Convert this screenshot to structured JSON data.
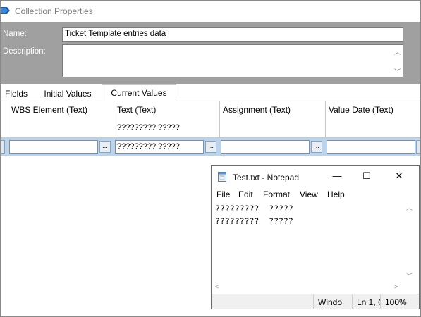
{
  "window": {
    "title": "Collection Properties"
  },
  "properties": {
    "name_label": "Name:",
    "name_value": "Ticket Template entries data",
    "description_label": "Description:",
    "description_value": ""
  },
  "tabs": [
    {
      "label": "Fields",
      "active": false
    },
    {
      "label": "Initial Values",
      "active": false
    },
    {
      "label": "Current Values",
      "active": true
    }
  ],
  "grid": {
    "columns": [
      {
        "title": "WBS Element  (Text)",
        "sample": ""
      },
      {
        "title": "Text  (Text)",
        "sample": "????????? ?????"
      },
      {
        "title": "Assignment  (Text)",
        "sample": ""
      },
      {
        "title": "Value Date  (Text)",
        "sample": ""
      }
    ],
    "edit_row": [
      "",
      "????????? ?????",
      "",
      ""
    ],
    "ellipsis": "..."
  },
  "notepad": {
    "title": "Test.txt - Notepad",
    "controls": {
      "minimize": "—",
      "maximize": "☐",
      "close": "✕"
    },
    "menu": [
      "File",
      "Edit",
      "Format",
      "View",
      "Help"
    ],
    "lines": [
      "?????????  ?????",
      "?????????  ?????"
    ],
    "status": {
      "encoding": "Windo",
      "position": "Ln 1, C",
      "zoom": "100%"
    }
  },
  "colors": {
    "panel_gray": "#a0a0a0",
    "row_highlight": "#bcd3ea"
  },
  "icons": {
    "app": "collection-app-icon",
    "notepad": "notepad-icon"
  }
}
